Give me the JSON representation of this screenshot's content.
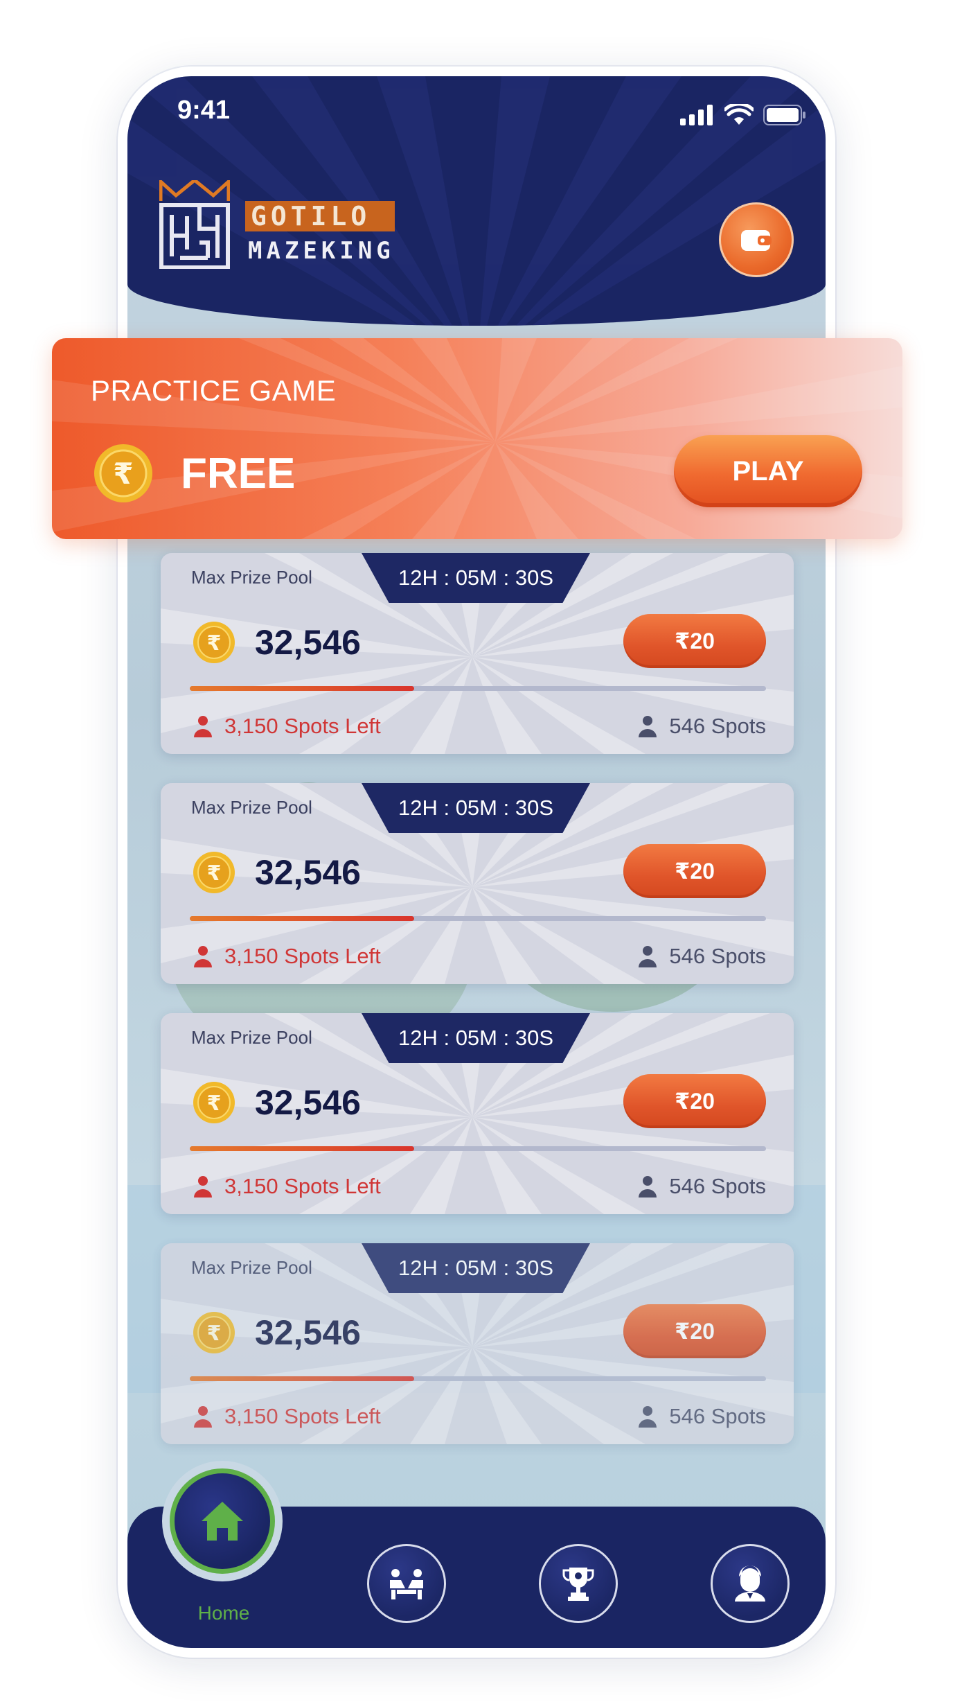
{
  "status_bar": {
    "time": "9:41"
  },
  "brand": {
    "line1": "GOTILO",
    "line2": "MAZEKING"
  },
  "header": {
    "wallet_icon": "wallet-icon"
  },
  "practice": {
    "title": "PRACTICE GAME",
    "price": "FREE",
    "play_label": "PLAY"
  },
  "contests": [
    {
      "label": "Max Prize Pool",
      "timer": "12H : 05M : 30S",
      "amount": "32,546",
      "fee": "₹20",
      "spots_left": "3,150 Spots Left",
      "spots_total": "546 Spots",
      "progress": 0.39
    },
    {
      "label": "Max Prize Pool",
      "timer": "12H : 05M : 30S",
      "amount": "32,546",
      "fee": "₹20",
      "spots_left": "3,150 Spots Left",
      "spots_total": "546 Spots",
      "progress": 0.39
    },
    {
      "label": "Max Prize Pool",
      "timer": "12H : 05M : 30S",
      "amount": "32,546",
      "fee": "₹20",
      "spots_left": "3,150 Spots Left",
      "spots_total": "546 Spots",
      "progress": 0.39
    },
    {
      "label": "Max Prize Pool",
      "timer": "12H : 05M : 30S",
      "amount": "32,546",
      "fee": "₹20",
      "spots_left": "3,150 Spots Left",
      "spots_total": "546 Spots",
      "progress": 0.39
    }
  ],
  "nav": {
    "home_label": "Home",
    "items": [
      "home-icon",
      "versus-icon",
      "trophy-icon",
      "profile-icon"
    ]
  },
  "colors": {
    "navy": "#1a2563",
    "accent_orange": "#ee5a2b",
    "home_green": "#5fb049",
    "spots_red": "#d03636"
  }
}
